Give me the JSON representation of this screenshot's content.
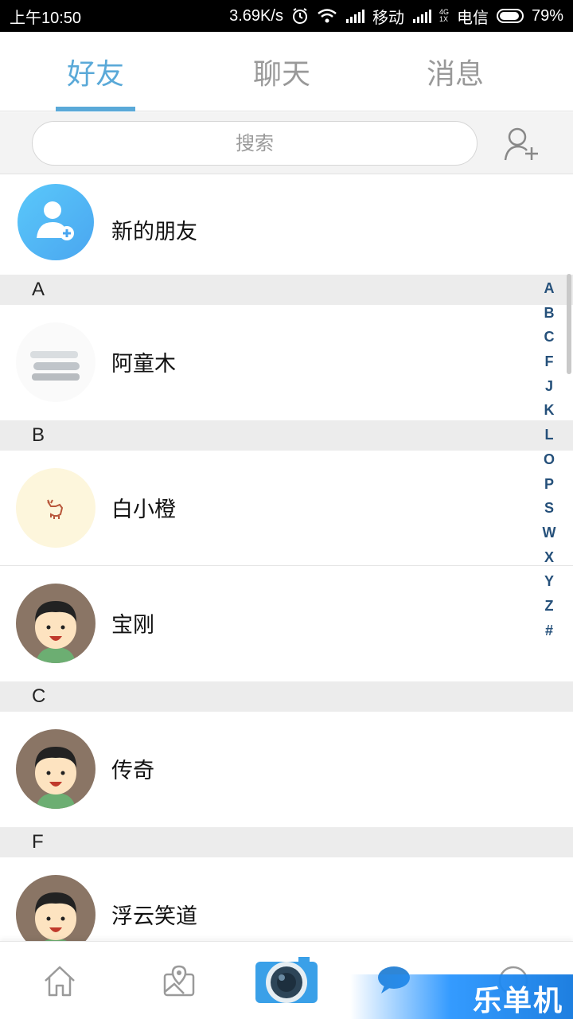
{
  "status_bar": {
    "time": "上午10:50",
    "speed": "3.69K/s",
    "carrier1": "移动",
    "net_top": "4G",
    "net_bottom": "1X",
    "carrier2": "电信",
    "battery": "79%"
  },
  "tabs": [
    {
      "label": "好友",
      "active": true
    },
    {
      "label": "聊天",
      "active": false
    },
    {
      "label": "消息",
      "active": false
    }
  ],
  "search": {
    "placeholder": "搜索"
  },
  "new_friend": {
    "label": "新的朋友"
  },
  "sections": {
    "A": "A",
    "B": "B",
    "C": "C",
    "F": "F"
  },
  "contacts": {
    "atongmu": "阿童木",
    "baixiaocheng": "白小橙",
    "baogang": "宝刚",
    "chuanqi": "传奇",
    "fuyunxiaodao": "浮云笑道"
  },
  "index_letters": [
    "A",
    "B",
    "C",
    "F",
    "J",
    "K",
    "L",
    "O",
    "P",
    "S",
    "W",
    "X",
    "Y",
    "Z",
    "#"
  ],
  "bottom_nav": [
    "home-icon",
    "map-icon",
    "camera-icon",
    "chat-icon",
    "profile-icon"
  ],
  "watermark": "乐单机",
  "colors": {
    "accent": "#5aa9d8",
    "index": "#25507a",
    "section_bg": "#ececec"
  }
}
